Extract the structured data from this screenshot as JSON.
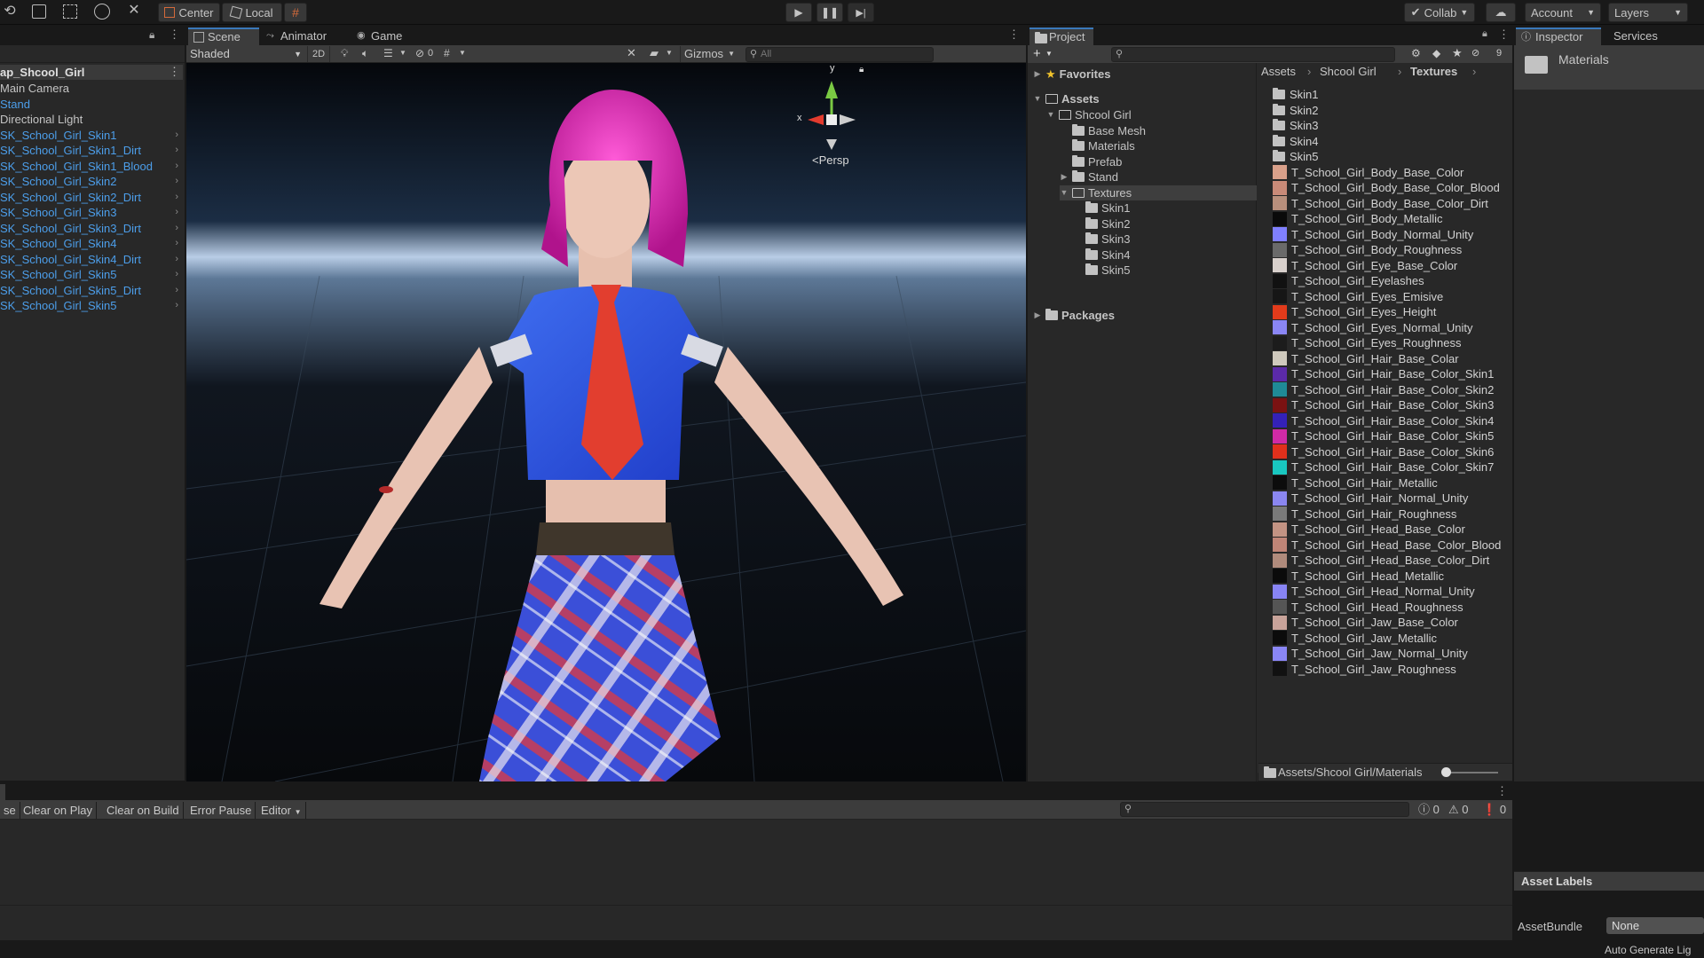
{
  "toolbar": {
    "center_label": "Center",
    "local_label": "Local",
    "collab_label": "Collab",
    "account_label": "Account",
    "layers_label": "Layers"
  },
  "hierarchy": {
    "root": "ap_Shcool_Girl",
    "items": [
      {
        "label": "Main Camera",
        "prefab": false,
        "expand": false
      },
      {
        "label": "Stand",
        "prefab": true,
        "expand": false
      },
      {
        "label": "Directional Light",
        "prefab": false,
        "expand": false
      },
      {
        "label": "SK_School_Girl_Skin1",
        "prefab": true,
        "expand": true
      },
      {
        "label": "SK_School_Girl_Skin1_Dirt",
        "prefab": true,
        "expand": true
      },
      {
        "label": "SK_School_Girl_Skin1_Blood",
        "prefab": true,
        "expand": true
      },
      {
        "label": "SK_School_Girl_Skin2",
        "prefab": true,
        "expand": true
      },
      {
        "label": "SK_School_Girl_Skin2_Dirt",
        "prefab": true,
        "expand": true
      },
      {
        "label": "SK_School_Girl_Skin3",
        "prefab": true,
        "expand": true
      },
      {
        "label": "SK_School_Girl_Skin3_Dirt",
        "prefab": true,
        "expand": true
      },
      {
        "label": "SK_School_Girl_Skin4",
        "prefab": true,
        "expand": true
      },
      {
        "label": "SK_School_Girl_Skin4_Dirt",
        "prefab": true,
        "expand": true
      },
      {
        "label": "SK_School_Girl_Skin5",
        "prefab": true,
        "expand": true
      },
      {
        "label": "SK_School_Girl_Skin5_Dirt",
        "prefab": true,
        "expand": true
      },
      {
        "label": "SK_School_Girl_Skin5",
        "prefab": true,
        "expand": true
      }
    ]
  },
  "scene": {
    "tabs": [
      "Scene",
      "Animator",
      "Game"
    ],
    "shading": "Shaded",
    "mode_2d": "2D",
    "hidden_count": "0",
    "gizmos": "Gizmos",
    "search_placeholder": "All",
    "persp": "Persp",
    "axis_x": "x",
    "axis_y": "y"
  },
  "project": {
    "tab": "Project",
    "hidden_count": "9",
    "favorites": "Favorites",
    "assets": "Assets",
    "tree": [
      {
        "label": "Shcool Girl",
        "depth": 1,
        "caret": "open"
      },
      {
        "label": "Base Mesh",
        "depth": 2,
        "caret": "none"
      },
      {
        "label": "Materials",
        "depth": 2,
        "caret": "none"
      },
      {
        "label": "Prefab",
        "depth": 2,
        "caret": "none"
      },
      {
        "label": "Stand",
        "depth": 2,
        "caret": "closed"
      },
      {
        "label": "Textures",
        "depth": 2,
        "caret": "open",
        "selected": true
      },
      {
        "label": "Skin1",
        "depth": 3,
        "caret": "none"
      },
      {
        "label": "Skin2",
        "depth": 3,
        "caret": "none"
      },
      {
        "label": "Skin3",
        "depth": 3,
        "caret": "none"
      },
      {
        "label": "Skin4",
        "depth": 3,
        "caret": "none"
      },
      {
        "label": "Skin5",
        "depth": 3,
        "caret": "none"
      }
    ],
    "packages": "Packages",
    "breadcrumb": [
      "Assets",
      "Shcool Girl",
      "Textures"
    ],
    "folders": [
      "Skin1",
      "Skin2",
      "Skin3",
      "Skin4",
      "Skin5"
    ],
    "textures": [
      {
        "name": "T_School_Girl_Body_Base_Color",
        "color": "#d9a08a"
      },
      {
        "name": "T_School_Girl_Body_Base_Color_Blood",
        "color": "#c98a78"
      },
      {
        "name": "T_School_Girl_Body_Base_Color_Dirt",
        "color": "#b88f7c"
      },
      {
        "name": "T_School_Girl_Body_Metallic",
        "color": "#0a0a0a"
      },
      {
        "name": "T_School_Girl_Body_Normal_Unity",
        "color": "#8080ff"
      },
      {
        "name": "T_School_Girl_Body_Roughness",
        "color": "#6a6a6a"
      },
      {
        "name": "T_School_Girl_Eye_Base_Color",
        "color": "#d8d0cc"
      },
      {
        "name": "T_School_Girl_Eyelashes",
        "color": "#111111"
      },
      {
        "name": "T_School_Girl_Eyes_Emisive",
        "color": "#161616"
      },
      {
        "name": "T_School_Girl_Eyes_Height",
        "color": "#e23b1b"
      },
      {
        "name": "T_School_Girl_Eyes_Normal_Unity",
        "color": "#8a86f5"
      },
      {
        "name": "T_School_Girl_Eyes_Roughness",
        "color": "#1c1c1c"
      },
      {
        "name": "T_School_Girl_Hair_Base_Colar",
        "color": "#cfc9bd"
      },
      {
        "name": "T_School_Girl_Hair_Base_Color_Skin1",
        "color": "#5b2aa8"
      },
      {
        "name": "T_School_Girl_Hair_Base_Color_Skin2",
        "color": "#1f8a96"
      },
      {
        "name": "T_School_Girl_Hair_Base_Color_Skin3",
        "color": "#7a1212"
      },
      {
        "name": "T_School_Girl_Hair_Base_Color_Skin4",
        "color": "#3421b8"
      },
      {
        "name": "T_School_Girl_Hair_Base_Color_Skin5",
        "color": "#d02aa6"
      },
      {
        "name": "T_School_Girl_Hair_Base_Color_Skin6",
        "color": "#e0301c"
      },
      {
        "name": "T_School_Girl_Hair_Base_Color_Skin7",
        "color": "#19c7c0"
      },
      {
        "name": "T_School_Girl_Hair_Metallic",
        "color": "#0c0c0c"
      },
      {
        "name": "T_School_Girl_Hair_Normal_Unity",
        "color": "#8a86f0"
      },
      {
        "name": "T_School_Girl_Hair_Roughness",
        "color": "#7a7a7a"
      },
      {
        "name": "T_School_Girl_Head_Base_Color",
        "color": "#c39383"
      },
      {
        "name": "T_School_Girl_Head_Base_Color_Blood",
        "color": "#c08577"
      },
      {
        "name": "T_School_Girl_Head_Base_Color_Dirt",
        "color": "#b08b7c"
      },
      {
        "name": "T_School_Girl_Head_Metallic",
        "color": "#0b0b0b"
      },
      {
        "name": "T_School_Girl_Head_Normal_Unity",
        "color": "#8884f4"
      },
      {
        "name": "T_School_Girl_Head_Roughness",
        "color": "#555555"
      },
      {
        "name": "T_School_Girl_Jaw_Base_Color",
        "color": "#c8a39a"
      },
      {
        "name": "T_School_Girl_Jaw_Metallic",
        "color": "#0b0b0b"
      },
      {
        "name": "T_School_Girl_Jaw_Normal_Unity",
        "color": "#8a86f6"
      },
      {
        "name": "T_School_Girl_Jaw_Roughness",
        "color": "#111111"
      }
    ],
    "footer_path": "Assets/Shcool Girl/Materials"
  },
  "inspector": {
    "tab": "Inspector",
    "services_tab": "Services",
    "title": "Materials",
    "asset_labels": "Asset Labels",
    "assetbundle_label": "AssetBundle",
    "assetbundle_value": "None"
  },
  "console": {
    "clear": "se",
    "clear_on_play": "Clear on Play",
    "clear_on_build": "Clear on Build",
    "error_pause": "Error Pause",
    "editor": "Editor",
    "log_count": "0",
    "warn_count": "0",
    "error_count": "0"
  },
  "status": {
    "auto_generate": "Auto Generate Lig"
  }
}
